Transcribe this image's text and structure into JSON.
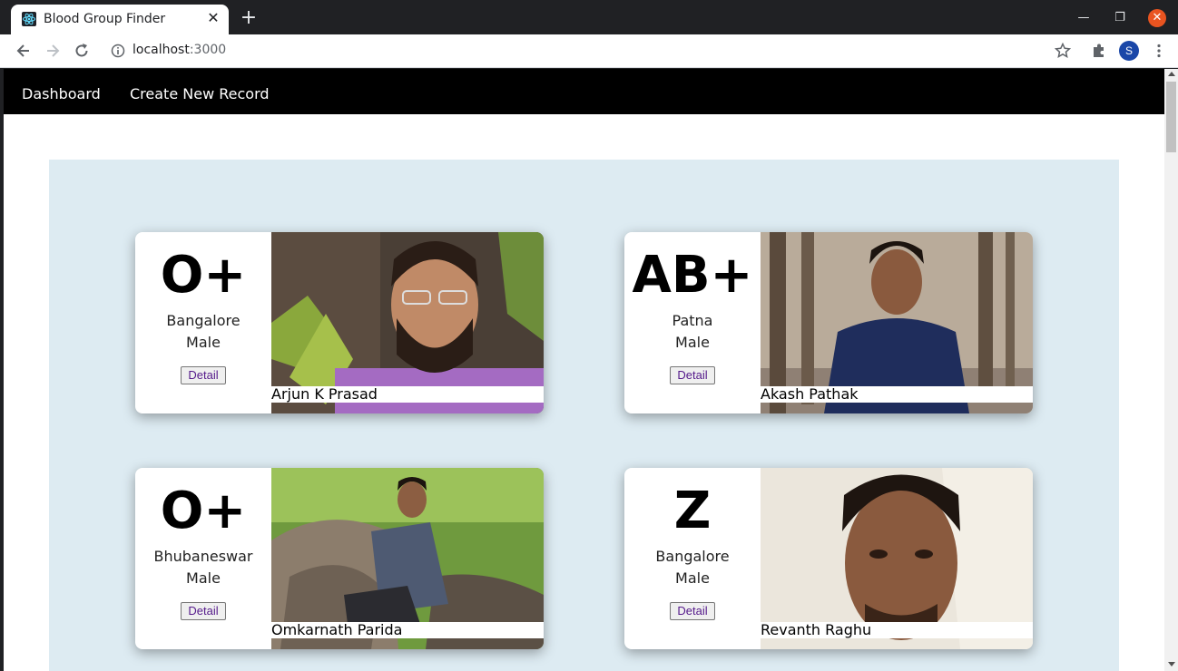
{
  "browser": {
    "tab_title": "Blood Group Finder",
    "url_host": "localhost",
    "url_port": ":3000",
    "profile_initial": "S"
  },
  "nav": {
    "dashboard": "Dashboard",
    "create": "Create New Record"
  },
  "donors": [
    {
      "blood_group": "O+",
      "city": "Bangalore",
      "gender": "Male",
      "button": "Detail",
      "name": "Arjun K Prasad"
    },
    {
      "blood_group": "AB+",
      "city": "Patna",
      "gender": "Male",
      "button": "Detail",
      "name": "Akash Pathak"
    },
    {
      "blood_group": "O+",
      "city": "Bhubaneswar",
      "gender": "Male",
      "button": "Detail",
      "name": "Omkarnath Parida"
    },
    {
      "blood_group": "Z",
      "city": "Bangalore",
      "gender": "Male",
      "button": "Detail",
      "name": "Revanth Raghu"
    }
  ],
  "colors": {
    "nav_bg": "#000000",
    "card_area_bg": "#ddebf2",
    "link_purple": "#551a8b"
  }
}
